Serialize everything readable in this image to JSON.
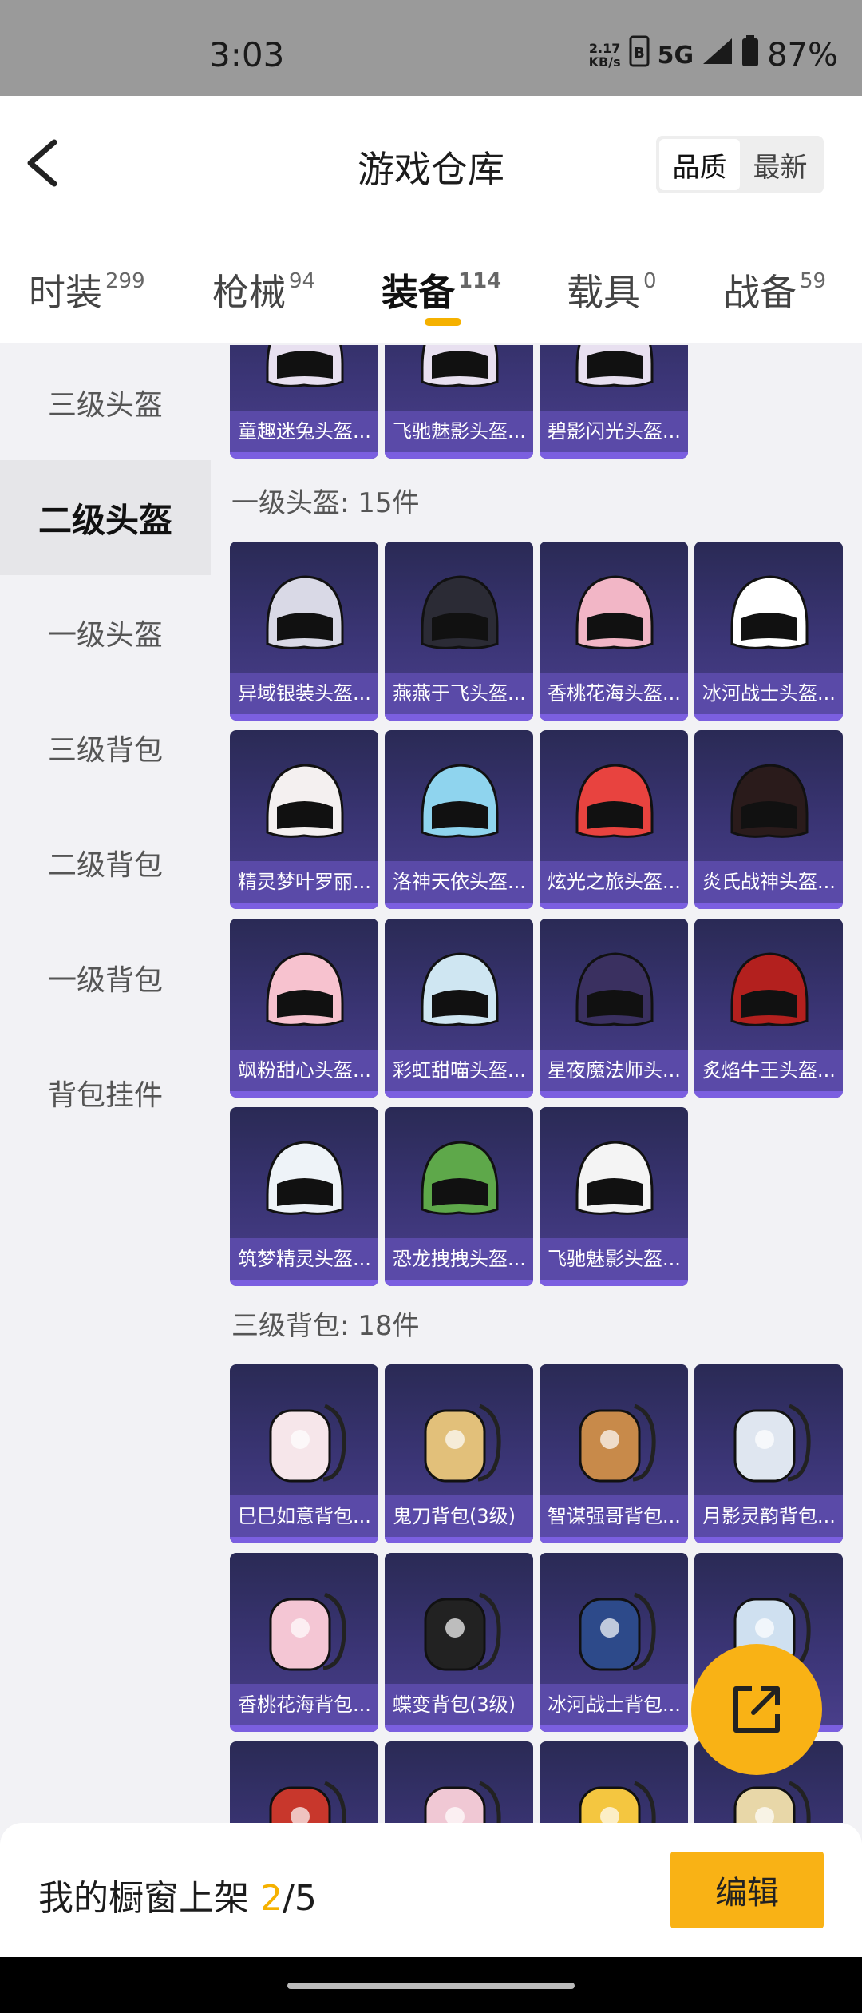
{
  "status_bar": {
    "time": "3:03",
    "net_speed_value": "2.17",
    "net_speed_unit": "KB/s",
    "network": "5G",
    "battery": "87%"
  },
  "header": {
    "title": "游戏仓库",
    "sort_options": [
      "品质",
      "最新"
    ],
    "sort_selected": "品质"
  },
  "tabs": [
    {
      "label": "时装",
      "count": "299"
    },
    {
      "label": "枪械",
      "count": "94"
    },
    {
      "label": "装备",
      "count": "114",
      "active": true
    },
    {
      "label": "载具",
      "count": "0"
    },
    {
      "label": "战备",
      "count": "59"
    }
  ],
  "sidebar": {
    "items": [
      "三级头盔",
      "二级头盔",
      "一级头盔",
      "三级背包",
      "二级背包",
      "一级背包",
      "背包挂件"
    ],
    "active": "二级头盔"
  },
  "content": {
    "top_partial_items": [
      "童趣迷兔头盔...",
      "飞驰魅影头盔...",
      "碧影闪光头盔..."
    ],
    "section1": {
      "title": "一级头盔: 15件",
      "items": [
        "异域银装头盔...",
        "燕燕于飞头盔...",
        "香桃花海头盔...",
        "冰河战士头盔...",
        "精灵梦叶罗丽...",
        "洛神天依头盔...",
        "炫光之旅头盔...",
        "炎氏战神头盔...",
        "飒粉甜心头盔...",
        "彩虹甜喵头盔...",
        "星夜魔法师头...",
        "炙焰牛王头盔...",
        "筑梦精灵头盔...",
        "恐龙拽拽头盔...",
        "飞驰魅影头盔..."
      ]
    },
    "section2": {
      "title": "三级背包: 18件",
      "items": [
        "巳巳如意背包...",
        "鬼刀背包(3级)",
        "智谋强哥背包...",
        "月影灵韵背包...",
        "香桃花海背包...",
        "蝶变背包(3级)",
        "冰河战士背包...",
        ""
      ]
    }
  },
  "footer": {
    "showcase_label": "我的橱窗上架",
    "showcase_current": "2",
    "showcase_total": "/5",
    "edit_label": "编辑"
  },
  "colors": {
    "accent": "#f9b215",
    "tile_bg": "#3b3576",
    "tile_label_bg": "#5a4aa8"
  }
}
